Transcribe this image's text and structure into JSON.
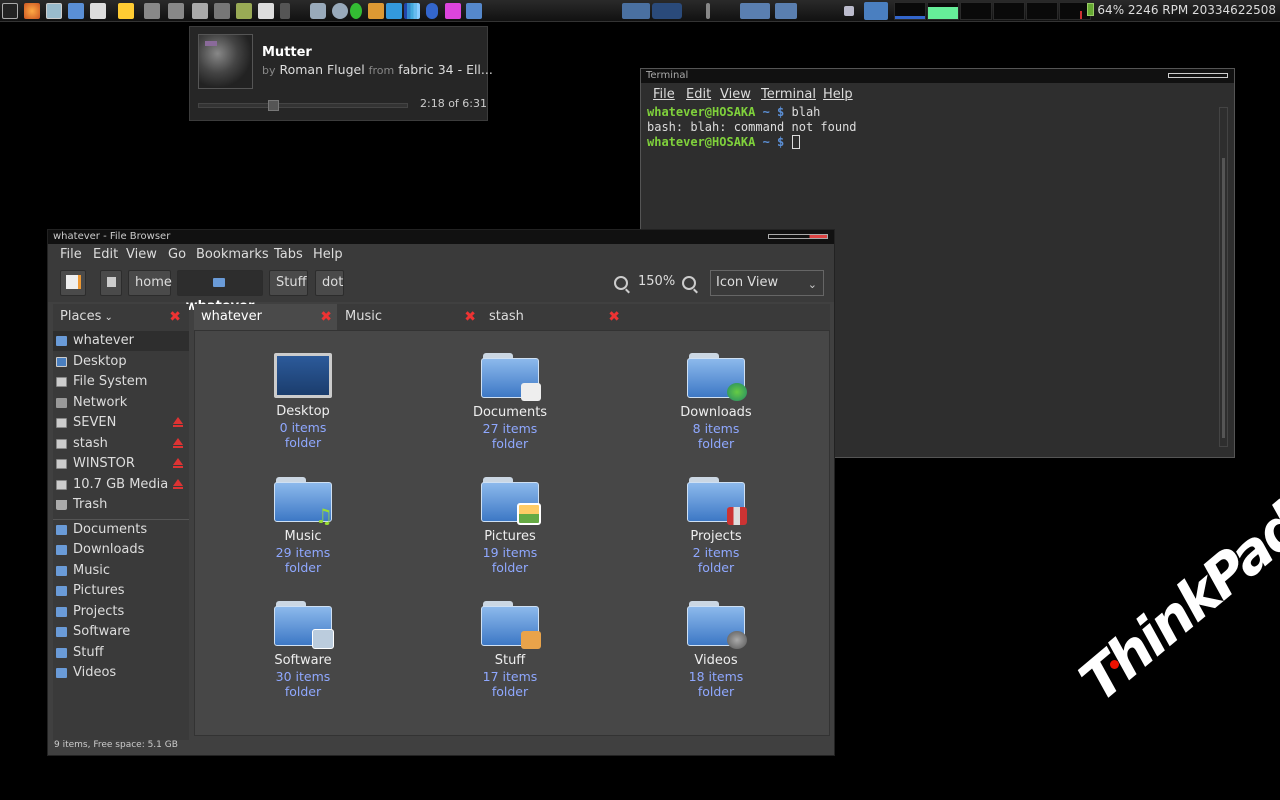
{
  "status_text": "64% 2246 RPM 20334622508",
  "music": {
    "title": "Mutter",
    "by_label": "by",
    "artist": "Roman Flugel",
    "from_label": "from",
    "album": "fabric 34 - Ell...",
    "time": "2:18 of 6:31",
    "progress": 0.35
  },
  "terminal": {
    "title": "Terminal",
    "menu": [
      "File",
      "Edit",
      "View",
      "Terminal",
      "Help"
    ],
    "lines": {
      "prompt1_user": "whatever@HOSAKA",
      "prompt1_rest": " ~ $",
      "cmd1": " blah",
      "output1": "bash: blah: command not found",
      "prompt2_user": "whatever@HOSAKA",
      "prompt2_rest": " ~ $"
    }
  },
  "file_browser": {
    "title": "whatever - File Browser",
    "menu": [
      "File",
      "Edit",
      "View",
      "Go",
      "Bookmarks",
      "Tabs",
      "Help"
    ],
    "path": [
      "home",
      "whatever",
      "Stuff",
      "dot"
    ],
    "zoom": "150%",
    "view_mode": "Icon View",
    "places_label": "Places",
    "places": [
      {
        "label": "whatever",
        "icon": "home-folder-icon"
      },
      {
        "label": "Desktop",
        "icon": "desktop-icon"
      },
      {
        "label": "File System",
        "icon": "drive-icon"
      },
      {
        "label": "Network",
        "icon": "network-icon"
      },
      {
        "label": "SEVEN",
        "icon": "drive-icon"
      },
      {
        "label": "stash",
        "icon": "drive-icon"
      },
      {
        "label": "WINSTOR",
        "icon": "drive-icon"
      },
      {
        "label": "10.7 GB Media",
        "icon": "drive-icon"
      },
      {
        "label": "Trash",
        "icon": "trash-icon"
      }
    ],
    "bookmarks": [
      "Documents",
      "Downloads",
      "Music",
      "Pictures",
      "Projects",
      "Software",
      "Stuff",
      "Videos"
    ],
    "tabs": [
      "whatever",
      "Music",
      "stash"
    ],
    "items": [
      {
        "name": "Desktop",
        "count": "0 items",
        "type": "folder"
      },
      {
        "name": "Documents",
        "count": "27 items",
        "type": "folder"
      },
      {
        "name": "Downloads",
        "count": "8 items",
        "type": "folder"
      },
      {
        "name": "Music",
        "count": "29 items",
        "type": "folder"
      },
      {
        "name": "Pictures",
        "count": "19 items",
        "type": "folder"
      },
      {
        "name": "Projects",
        "count": "2 items",
        "type": "folder"
      },
      {
        "name": "Software",
        "count": "30 items",
        "type": "folder"
      },
      {
        "name": "Stuff",
        "count": "17 items",
        "type": "folder"
      },
      {
        "name": "Videos",
        "count": "18 items",
        "type": "folder"
      }
    ],
    "status": "9 items, Free space: 5.1 GB"
  },
  "logo": "ThinkPad"
}
